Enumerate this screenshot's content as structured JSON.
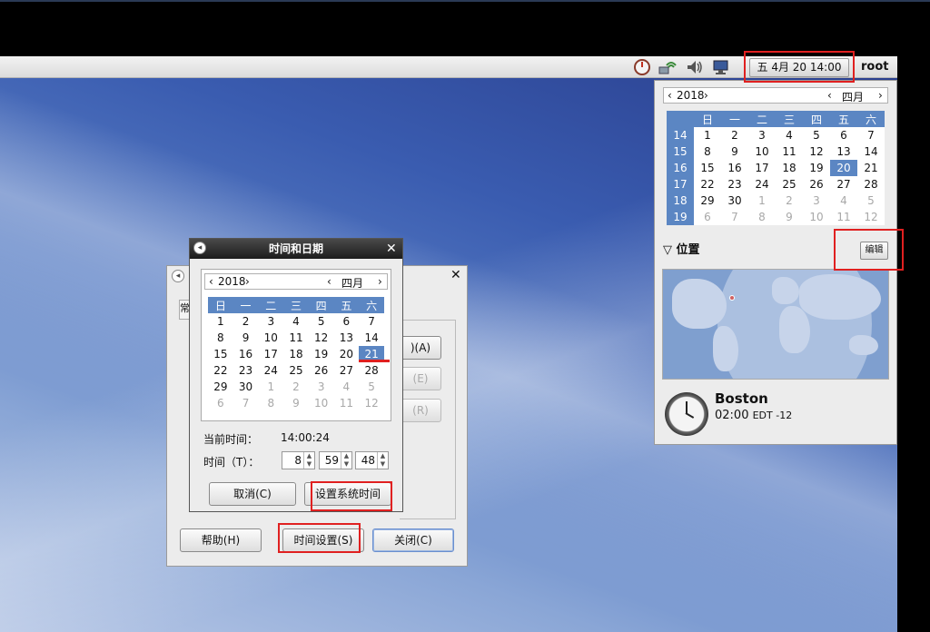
{
  "panel": {
    "clock": "五 4月 20 14:00",
    "user": "root",
    "tray_icons": [
      "compass-icon",
      "network-icon",
      "volume-icon",
      "monitor-icon"
    ]
  },
  "popup_calendar": {
    "year": "2018",
    "month": "四月",
    "weekdays": [
      "日",
      "一",
      "二",
      "三",
      "四",
      "五",
      "六"
    ],
    "weeks": [
      {
        "num": "14",
        "days": [
          "1",
          "2",
          "3",
          "4",
          "5",
          "6",
          "7"
        ],
        "dim": []
      },
      {
        "num": "15",
        "days": [
          "8",
          "9",
          "10",
          "11",
          "12",
          "13",
          "14"
        ],
        "dim": []
      },
      {
        "num": "16",
        "days": [
          "15",
          "16",
          "17",
          "18",
          "19",
          "20",
          "21"
        ],
        "dim": [],
        "sel": 5
      },
      {
        "num": "17",
        "days": [
          "22",
          "23",
          "24",
          "25",
          "26",
          "27",
          "28"
        ],
        "dim": []
      },
      {
        "num": "18",
        "days": [
          "29",
          "30",
          "1",
          "2",
          "3",
          "4",
          "5"
        ],
        "dim": [
          2,
          3,
          4,
          5,
          6
        ]
      },
      {
        "num": "19",
        "days": [
          "6",
          "7",
          "8",
          "9",
          "10",
          "11",
          "12"
        ],
        "dim": [
          0,
          1,
          2,
          3,
          4,
          5,
          6
        ]
      }
    ],
    "location_title": "位置",
    "edit_label": "编辑",
    "city": "Boston",
    "city_time": "02:00",
    "city_tz": "EDT -12"
  },
  "back_dialog": {
    "tab_char": "常",
    "buttons": [
      ")(A)",
      "(E)",
      "(R)"
    ],
    "help": "帮助(H)",
    "time_settings": "时间设置(S)",
    "close": "关闭(C)"
  },
  "time_dialog": {
    "title": "时间和日期",
    "year": "2018",
    "month": "四月",
    "weekdays": [
      "日",
      "一",
      "二",
      "三",
      "四",
      "五",
      "六"
    ],
    "weeks": [
      {
        "days": [
          "1",
          "2",
          "3",
          "4",
          "5",
          "6",
          "7"
        ],
        "dim": []
      },
      {
        "days": [
          "8",
          "9",
          "10",
          "11",
          "12",
          "13",
          "14"
        ],
        "dim": []
      },
      {
        "days": [
          "15",
          "16",
          "17",
          "18",
          "19",
          "20",
          "21"
        ],
        "dim": [],
        "sel": 6
      },
      {
        "days": [
          "22",
          "23",
          "24",
          "25",
          "26",
          "27",
          "28"
        ],
        "dim": []
      },
      {
        "days": [
          "29",
          "30",
          "1",
          "2",
          "3",
          "4",
          "5"
        ],
        "dim": [
          2,
          3,
          4,
          5,
          6
        ]
      },
      {
        "days": [
          "6",
          "7",
          "8",
          "9",
          "10",
          "11",
          "12"
        ],
        "dim": [
          0,
          1,
          2,
          3,
          4,
          5,
          6
        ]
      }
    ],
    "current_time_label": "当前时间：",
    "current_time": "14:00:24",
    "time_label": "时间（T）：",
    "hour": "8",
    "minute": "59",
    "second": "48",
    "cancel": "取消(C)",
    "set_time": "设置系统时间"
  }
}
